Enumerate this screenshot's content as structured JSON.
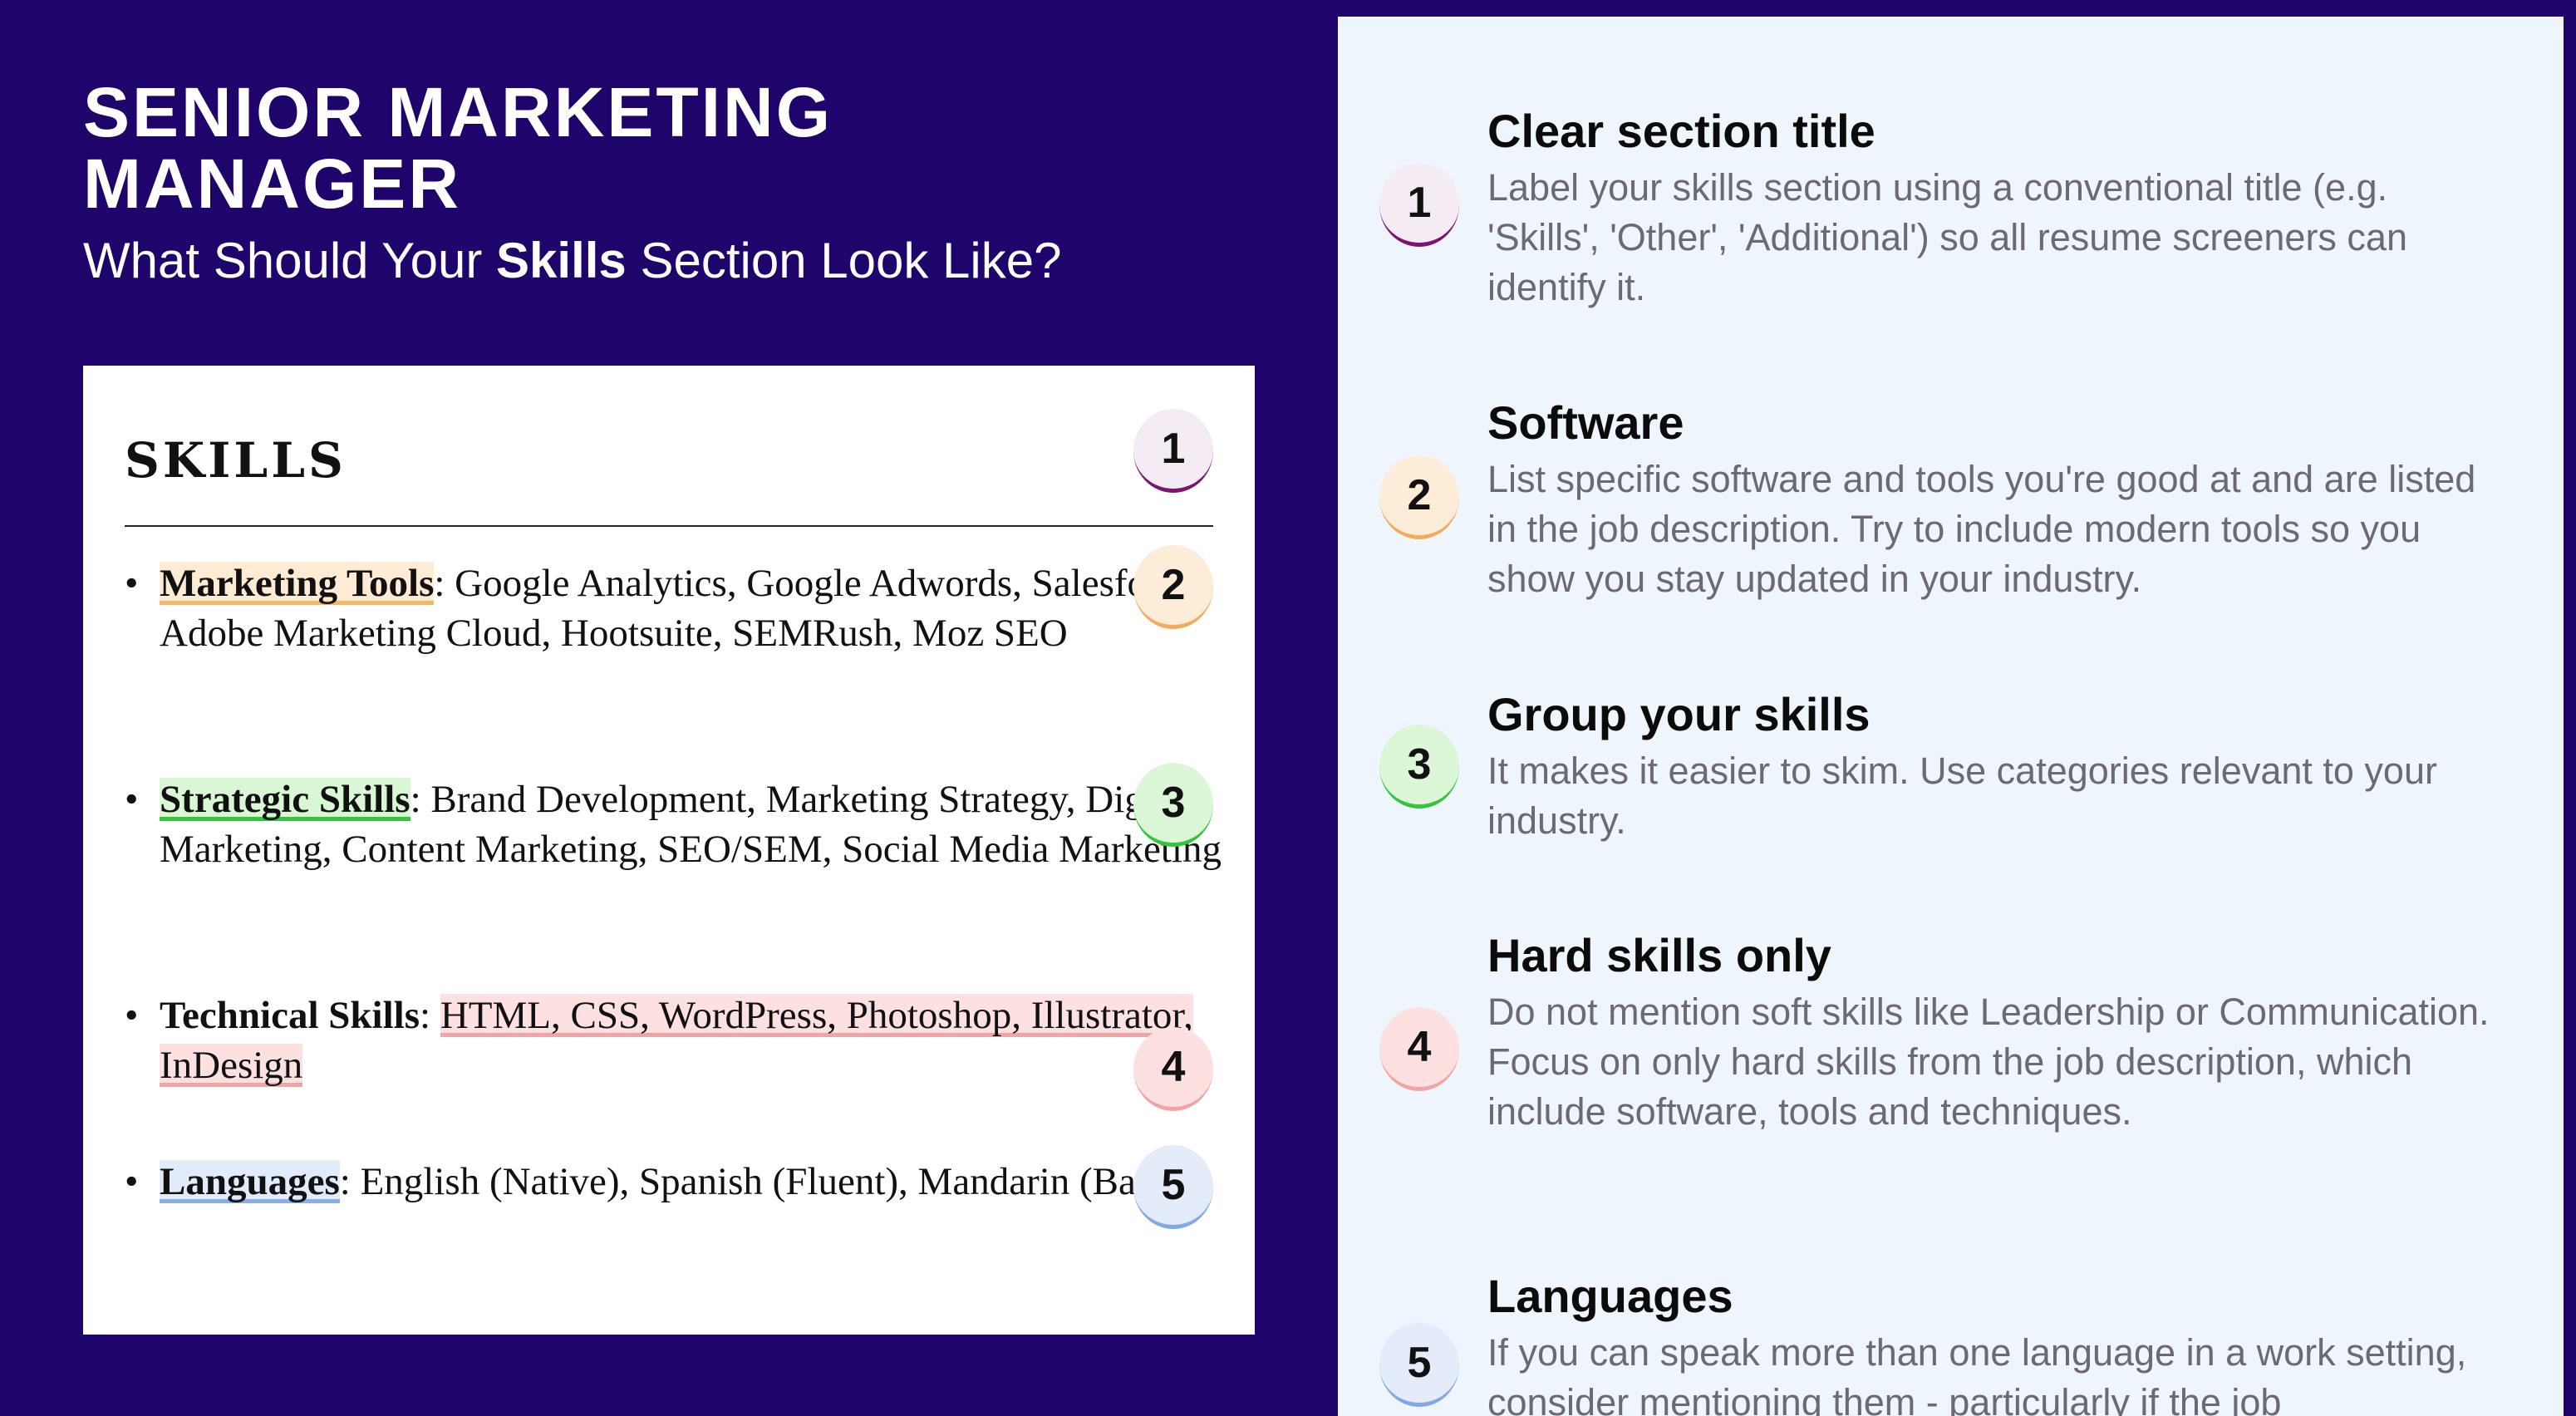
{
  "header": {
    "job_title": "SENIOR MARKETING MANAGER",
    "subtitle_before": "What Should Your ",
    "subtitle_bold": "Skills",
    "subtitle_after": " Section Look Like?"
  },
  "resume": {
    "section_heading": "SKILLS",
    "items": [
      {
        "category": "Marketing Tools",
        "separator": ": ",
        "text": "Google Analytics, Google Adwords, Salesforce, Adobe Marketing Cloud, Hootsuite, SEMRush, Moz SEO",
        "highlight": "category",
        "highlight_color": "#f3b66b"
      },
      {
        "category": "Strategic Skills",
        "separator": ": ",
        "text": "Brand Development, Marketing Strategy, Digital Marketing, Content Marketing, SEO/SEM, Social Media Marketing",
        "highlight": "category",
        "highlight_color": "#34c63a"
      },
      {
        "category": "Technical Skills",
        "separator": ": ",
        "text": "HTML, CSS, WordPress, Photoshop, Illustrator, InDesign",
        "highlight": "text",
        "highlight_color": "#f1a4a4"
      },
      {
        "category": "Languages",
        "separator": ": ",
        "text": "English (Native), Spanish (Fluent), Mandarin (Basic)",
        "highlight": "category",
        "highlight_color": "#8aaee8"
      }
    ],
    "badges": [
      "1",
      "2",
      "3",
      "4",
      "5"
    ]
  },
  "tips": [
    {
      "number": "1",
      "title": "Clear section title",
      "text": "Label your skills section using a conventional title (e.g. 'Skills', 'Other', 'Additional') so all resume screeners can identify it.",
      "color": "#7a1670"
    },
    {
      "number": "2",
      "title": "Software",
      "text": "List specific software and tools you're good at and are listed in the job description. Try to include modern tools so you show you stay updated in your industry.",
      "color": "#f1ad5e"
    },
    {
      "number": "3",
      "title": "Group your skills",
      "text": "It makes it easier to skim. Use categories relevant to your industry.",
      "color": "#35c53b"
    },
    {
      "number": "4",
      "title": "Hard skills only",
      "text": "Do not mention soft skills like Leadership or Communication. Focus on only hard skills from the job description, which include software, tools and techniques.",
      "color": "#f2a4a4"
    },
    {
      "number": "5",
      "title": "Languages",
      "text": "If you can speak more than one language in a work setting, consider mentioning them - particularly if the job",
      "color": "#84a8e6"
    }
  ],
  "colors": {
    "background": "#1e046b",
    "panel": "#eef5fd",
    "card": "#ffffff"
  }
}
